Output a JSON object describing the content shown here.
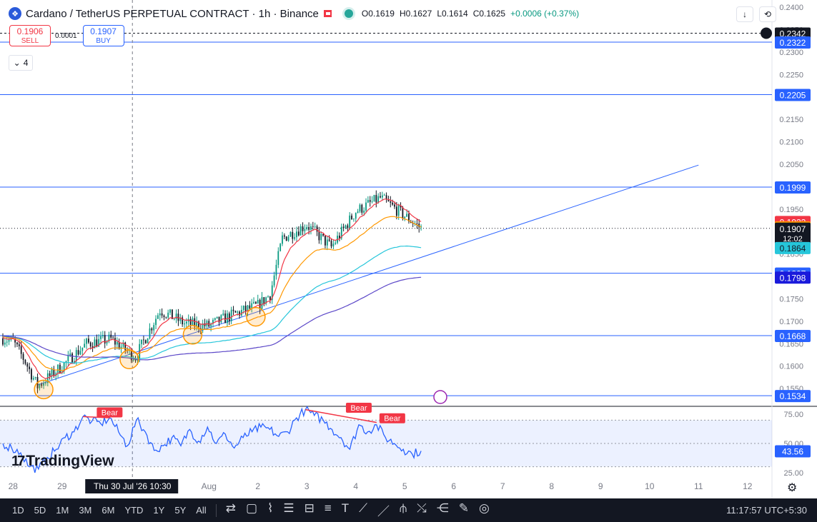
{
  "header": {
    "title": "Cardano / TetherUS PERPETUAL CONTRACT · 1h · Binance",
    "open": "O0.1619",
    "high": "H0.1627",
    "low": "L0.1614",
    "close": "C0.1625",
    "change": "+0.0006 (+0.37%)"
  },
  "trade": {
    "sell_price": "0.1906",
    "sell_label": "SELL",
    "spread": "0.0001",
    "buy_price": "0.1907",
    "buy_label": "BUY"
  },
  "indicators_count": "4",
  "logo_text": "TradingView",
  "colors": {
    "up": "#089981",
    "down": "#131722",
    "hline": "#2962ff",
    "ema_fast": "#f23645",
    "ema_mid": "#ff9800",
    "ema_slow": "#26c6da",
    "ema_long": "#5b47c8",
    "rsi": "#2962ff",
    "bear": "#f23645"
  },
  "toolbar": {
    "ranges": [
      "1D",
      "5D",
      "1M",
      "3M",
      "6M",
      "YTD",
      "1Y",
      "5Y",
      "All"
    ],
    "tool_icons": [
      "compare-icon",
      "rectangle-icon",
      "path-icon",
      "fib-icon",
      "long-position-icon",
      "parallel-channel-icon",
      "text-icon",
      "trendline-icon",
      "line-icon",
      "pitchfork-icon",
      "polyline-icon",
      "projection-icon",
      "brush-icon",
      "measure-icon"
    ],
    "clock": "11:17:57 UTC+5:30"
  },
  "chart_data": {
    "type": "line",
    "title": "Cardano / TetherUS PERPETUAL CONTRACT · 1h · Binance",
    "ylim": [
      0.1512,
      0.2408
    ],
    "y_ticks": [
      "0.2400",
      "0.2350",
      "0.2300",
      "0.2250",
      "0.2200",
      "0.2150",
      "0.2100",
      "0.2050",
      "0.2000",
      "0.1950",
      "0.1900",
      "0.1850",
      "0.1800",
      "0.1750",
      "0.1700",
      "0.1650",
      "0.1600",
      "0.1550"
    ],
    "x_ticks": [
      "28",
      "29",
      "30",
      "Aug",
      "2",
      "3",
      "4",
      "5",
      "6",
      "7",
      "8",
      "9",
      "10",
      "11",
      "12"
    ],
    "crosshair_time": "Thu 30 Jul '26  10:30",
    "price_series": {
      "name": "ADA/USDT 1h",
      "x": [
        "27 Jul 19:00",
        "28 Jul 00:00",
        "28 Jul 06:00",
        "28 Jul 12:00",
        "29 Jul 00:00",
        "29 Jul 12:00",
        "30 Jul 00:00",
        "30 Jul 12:00",
        "31 Jul 00:00",
        "31 Jul 12:00",
        "1 Aug 00:00",
        "1 Aug 12:00",
        "2 Aug 00:00",
        "2 Aug 06:00",
        "2 Aug 12:00",
        "3 Aug 00:00",
        "3 Aug 12:00",
        "4 Aug 00:00",
        "4 Aug 12:00",
        "5 Aug 00:00",
        "5 Aug 08:00"
      ],
      "values": [
        0.1662,
        0.1655,
        0.161,
        0.1555,
        0.16,
        0.165,
        0.166,
        0.162,
        0.1725,
        0.1695,
        0.169,
        0.1715,
        0.1735,
        0.176,
        0.1885,
        0.1915,
        0.1865,
        0.1945,
        0.1975,
        0.1935,
        0.1907
      ]
    },
    "ma_lines": [
      {
        "name": "EMA fast",
        "color": "#f23645",
        "last": 0.1922
      },
      {
        "name": "EMA mid",
        "color": "#ff9800",
        "last": 0.191
      },
      {
        "name": "EMA slow",
        "color": "#26c6da",
        "last": 0.1864
      },
      {
        "name": "EMA long",
        "color": "#5b47c8",
        "last": 0.1798
      }
    ],
    "horizontal_levels": [
      "0.2342",
      "0.2322",
      "0.2205",
      "0.1999",
      "0.1807",
      "0.1668",
      "0.1534"
    ],
    "price_labels": [
      {
        "text": "0.2342",
        "value": 0.2342,
        "bg": "#131722",
        "fg": "#ffffff"
      },
      {
        "text": "0.2322",
        "value": 0.2322,
        "bg": "#2962ff",
        "fg": "#ffffff"
      },
      {
        "text": "0.2205",
        "value": 0.2205,
        "bg": "#2962ff",
        "fg": "#ffffff"
      },
      {
        "text": "0.1999",
        "value": 0.1999,
        "bg": "#2962ff",
        "fg": "#ffffff"
      },
      {
        "text": "0.1922",
        "value": 0.1922,
        "bg": "#f23645",
        "fg": "#ffffff"
      },
      {
        "text": "0.1910",
        "value": 0.191,
        "bg": "#ff9800",
        "fg": "#ffffff"
      },
      {
        "text": "0.1907",
        "value": 0.1907,
        "bg": "#131722",
        "fg": "#ffffff",
        "extra": "12:02"
      },
      {
        "text": "0.1864",
        "value": 0.1864,
        "bg": "#26c6da",
        "fg": "#131722"
      },
      {
        "text": "0.1807",
        "value": 0.1807,
        "bg": "#2962ff",
        "fg": "#ffffff"
      },
      {
        "text": "0.1798",
        "value": 0.1798,
        "bg": "#1a1adb",
        "fg": "#ffffff"
      },
      {
        "text": "0.1668",
        "value": 0.1668,
        "bg": "#2962ff",
        "fg": "#ffffff"
      },
      {
        "text": "0.1534",
        "value": 0.1534,
        "bg": "#2962ff",
        "fg": "#ffffff"
      }
    ],
    "trendlines": [
      {
        "from": [
          "28 Jul 12:00",
          0.1558
        ],
        "to": [
          "11 Aug 00:00",
          0.2048
        ]
      }
    ],
    "rsi": {
      "name": "RSI",
      "ylim": [
        20,
        80
      ],
      "y_ticks": [
        "75.00",
        "50.00",
        "25.00"
      ],
      "band": [
        30,
        70
      ],
      "last": "43.56",
      "values": [
        50,
        46,
        42,
        30,
        28,
        38,
        45,
        55,
        60,
        73,
        69,
        67,
        72,
        60,
        48,
        70,
        60,
        44,
        48,
        55,
        48,
        62,
        52,
        64,
        50,
        58,
        46,
        55,
        60,
        64,
        62,
        56,
        60,
        72,
        79,
        74,
        70,
        62,
        55,
        45,
        66,
        60,
        66,
        55,
        50,
        45,
        41,
        43.56
      ]
    },
    "divergence_labels": [
      "Bear",
      "Bear",
      "Bear"
    ]
  }
}
